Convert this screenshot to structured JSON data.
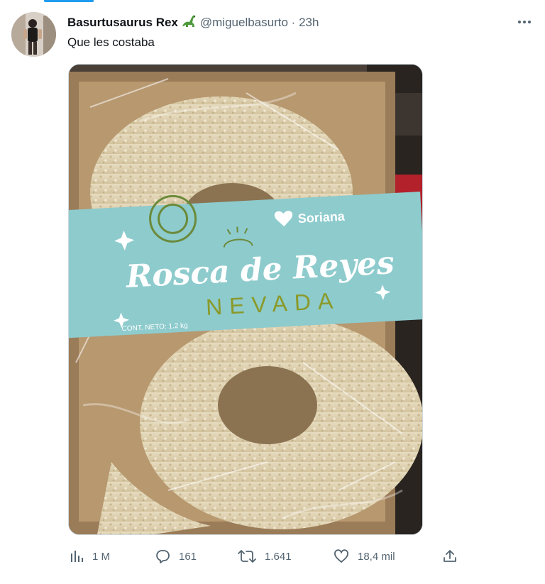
{
  "tweet": {
    "author_name": "Basurtusaurus Rex",
    "author_emoji_icon": "sauropod-icon",
    "handle": "@miguelbasurto",
    "separator": "·",
    "time": "23h",
    "text": "Que les costaba",
    "more_icon": "more-horizontal-icon"
  },
  "media": {
    "label": {
      "brand": "Soriana",
      "title_line1": "Rosca de Reyes",
      "title_line2": "NEVADA",
      "net_content": "CONT. NETO: 1.2 kg"
    }
  },
  "actions": {
    "views": "1 M",
    "replies": "161",
    "retweets": "1.641",
    "likes": "18,4 mil"
  },
  "colors": {
    "accent": "#1d9bf0",
    "secondary_text": "#536471",
    "label_teal": "#7fc4c6"
  }
}
